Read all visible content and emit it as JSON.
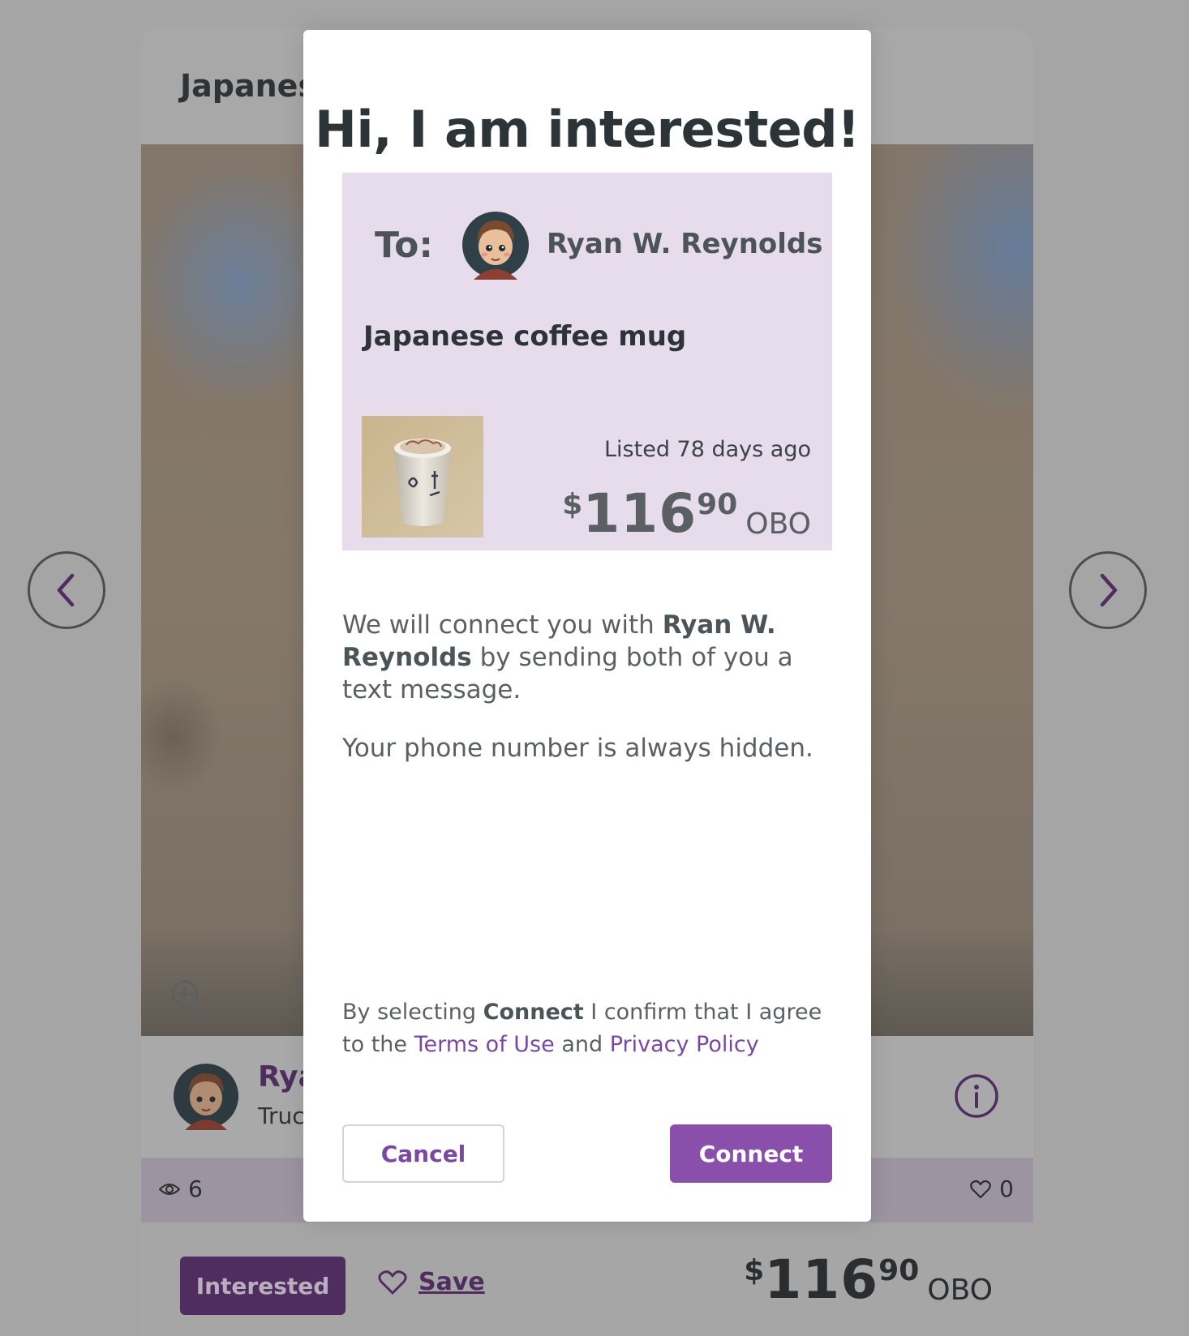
{
  "listing": {
    "title": "Japanese coffee mug",
    "seller_name": "Ryan W. Reynolds",
    "seller_subtitle": "Truck",
    "views": "6",
    "likes": "0",
    "interested_label": "Interested",
    "save_label": "Save",
    "price": {
      "currency": "$",
      "whole": "116",
      "cents": "90",
      "obo": "OBO"
    }
  },
  "modal": {
    "title": "Hi, I am interested!",
    "to_label": "To:",
    "recipient_name": "Ryan W. Reynolds",
    "item_title": "Japanese coffee mug",
    "listed_text": "Listed 78 days ago",
    "price": {
      "currency": "$",
      "whole": "116",
      "cents": "90",
      "obo": "OBO"
    },
    "connect_prefix": "We will connect you with ",
    "connect_name": "Ryan W. Reynolds",
    "connect_suffix": " by sending both of you a text message.",
    "hidden_notice": "Your phone number is always hidden.",
    "terms_prefix": "By selecting ",
    "terms_bold": "Connect",
    "terms_middle": " I confirm that I agree to the ",
    "terms_link": "Terms of Use",
    "terms_and": " and ",
    "privacy_link": "Privacy Policy",
    "cancel_label": "Cancel",
    "connect_label": "Connect"
  },
  "colors": {
    "accent": "#8a4fab",
    "link": "#7a48a3",
    "summary_bg": "#e6dcec",
    "overlay_bg": "#a5a5a5"
  },
  "icons": {
    "prev": "chevron-left-icon",
    "next": "chevron-right-icon",
    "zoom": "zoom-in-icon",
    "info": "info-icon",
    "views": "eye-icon",
    "likes": "heart-icon",
    "save": "heart-outline-icon"
  }
}
